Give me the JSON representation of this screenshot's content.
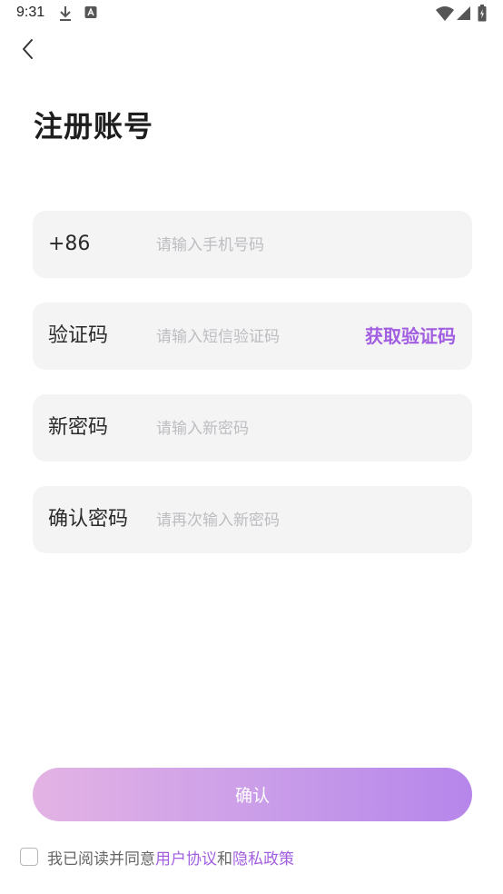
{
  "status_bar": {
    "time": "9:31",
    "left_icons": [
      "download-icon",
      "a-icon"
    ],
    "right_icons": [
      "wifi-icon",
      "signal-icon",
      "battery-icon"
    ]
  },
  "header": {
    "back_icon": "chevron-left-icon",
    "title": "注册账号"
  },
  "form": {
    "phone": {
      "label": "+86",
      "placeholder": "请输入手机号码",
      "value": ""
    },
    "code": {
      "label": "验证码",
      "placeholder": "请输入短信验证码",
      "value": "",
      "get_code_label": "获取验证码"
    },
    "new_password": {
      "label": "新密码",
      "placeholder": "请输入新密码",
      "value": ""
    },
    "confirm_password": {
      "label": "确认密码",
      "placeholder": "请再次输入新密码",
      "value": ""
    }
  },
  "confirm_button": {
    "label": "确认"
  },
  "agreement": {
    "checked": false,
    "prefix": "我已阅读并同意",
    "user_agreement": "用户协议",
    "conjunction": "和",
    "privacy_policy": "隐私政策"
  },
  "colors": {
    "accent": "#a25ee0",
    "field_bg": "#f4f4f4",
    "gradient_start": "#e3b3e4",
    "gradient_end": "#b686ea"
  }
}
